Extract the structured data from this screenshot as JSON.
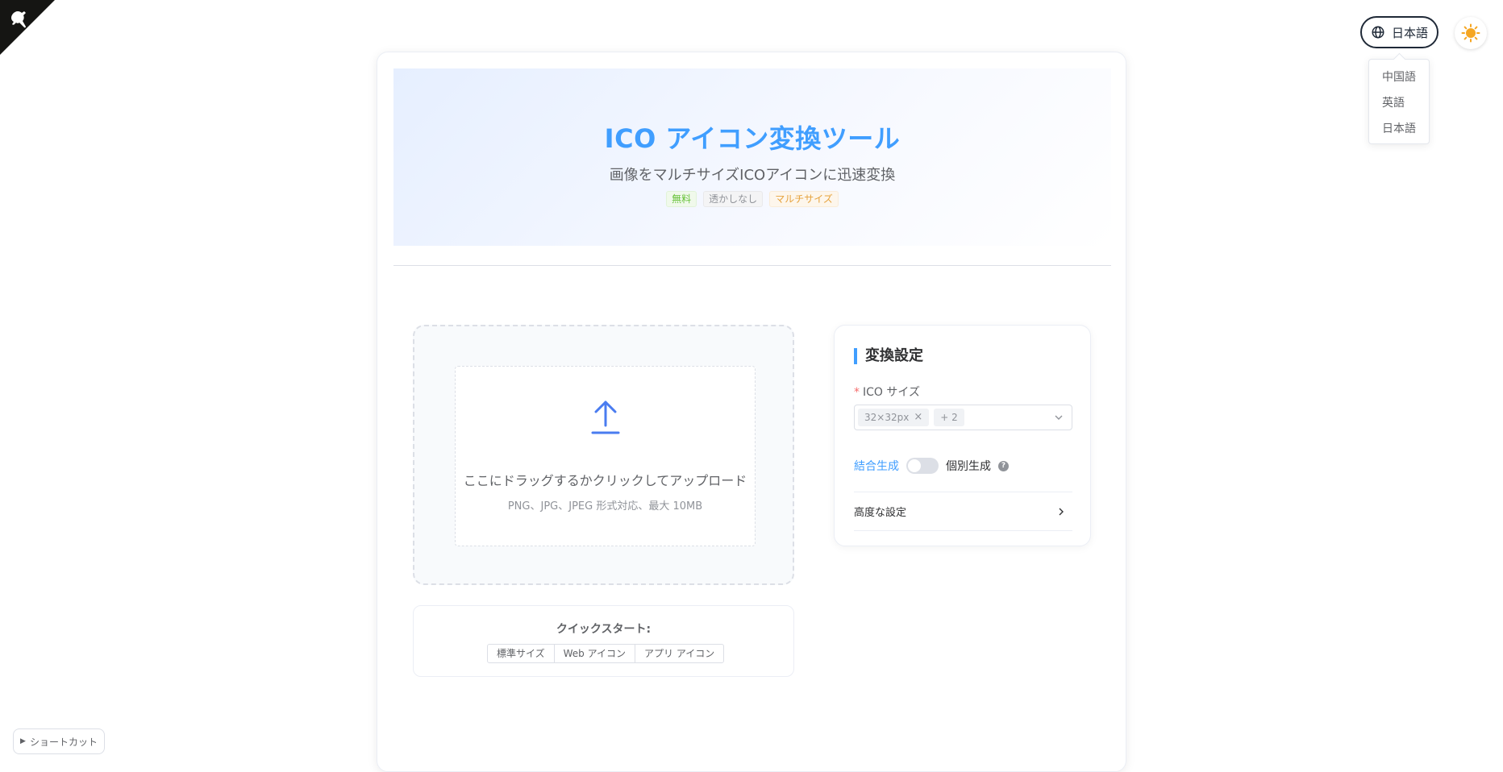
{
  "language": {
    "current": "日本語",
    "options": [
      "中国語",
      "英語",
      "日本語"
    ]
  },
  "hero": {
    "title": "ICO アイコン変換ツール",
    "subtitle": "画像をマルチサイズICOアイコンに迅速変換",
    "tags": [
      "無料",
      "透かしなし",
      "マルチサイズ"
    ]
  },
  "upload": {
    "text": "ここにドラッグするかクリックしてアップロード",
    "hint": "PNG、JPG、JPEG 形式対応、最大 10MB"
  },
  "quick_start": {
    "label": "クイックスタート:",
    "buttons": [
      "標準サイズ",
      "Web アイコン",
      "アプリ アイコン"
    ]
  },
  "settings": {
    "title": "変換設定",
    "size_label": "ICO サイズ",
    "required_mark": "*",
    "selected_size": "32×32px",
    "more_count": "+ 2",
    "mode_combined": "結合生成",
    "mode_separate": "個別生成",
    "help_mark": "?",
    "advanced": "高度な設定"
  },
  "shortcut": {
    "label": "ショートカット"
  },
  "colors": {
    "primary": "#409eff",
    "text": "#303133",
    "border": "#dcdfe6"
  }
}
